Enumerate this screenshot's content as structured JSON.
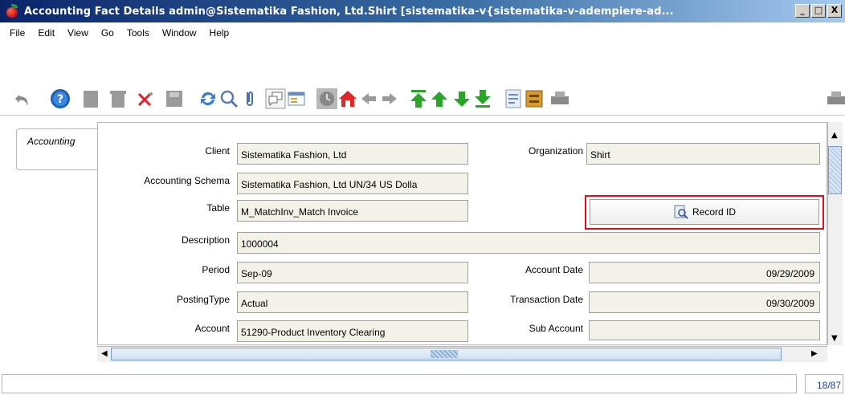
{
  "window": {
    "title": "Accounting Fact Details  admin@Sistematika Fashion, Ltd.Shirt [sistematika-v{sistematika-v-adempiere-ad...",
    "minimize": "_",
    "maximize": "□",
    "close": "X"
  },
  "menu": {
    "file": "File",
    "edit": "Edit",
    "view": "View",
    "go": "Go",
    "tools": "Tools",
    "window": "Window",
    "help": "Help"
  },
  "tab": {
    "label": "Accounting"
  },
  "form": {
    "client_label": "Client",
    "client_value": "Sistematika Fashion, Ltd",
    "organization_label": "Organization",
    "organization_value": "Shirt",
    "schema_label": "Accounting Schema",
    "schema_value": "Sistematika Fashion, Ltd UN/34 US Dolla",
    "table_label": "Table",
    "table_value": "M_MatchInv_Match Invoice",
    "record_button": "Record ID",
    "description_label": "Description",
    "description_value": "1000004",
    "period_label": "Period",
    "period_value": "Sep-09",
    "account_date_label": "Account Date",
    "account_date_value": "09/29/2009",
    "posting_type_label": "PostingType",
    "posting_type_value": "Actual",
    "transaction_date_label": "Transaction Date",
    "transaction_date_value": "09/30/2009",
    "account_label": "Account",
    "account_value": "51290-Product Inventory Clearing",
    "sub_account_label": "Sub Account",
    "sub_account_value": ""
  },
  "status": {
    "message": "",
    "record_count": "18/87"
  },
  "colors": {
    "title_gradient_start": "#0a246a",
    "field_bg": "#f4f2e8",
    "highlight": "#e0101a",
    "green_nav": "#2aa52a"
  },
  "icons": [
    "undo-icon",
    "help-icon",
    "new-record-icon",
    "delete-icon",
    "delete-selection-icon",
    "save-icon",
    "refresh-icon",
    "find-icon",
    "attachment-icon",
    "chat-icon",
    "grid-toggle-icon",
    "history-icon",
    "home-icon",
    "back-icon",
    "forward-icon",
    "first-record-icon",
    "previous-record-icon",
    "next-record-icon",
    "last-record-icon",
    "report-icon",
    "archive-icon",
    "print-icon"
  ]
}
